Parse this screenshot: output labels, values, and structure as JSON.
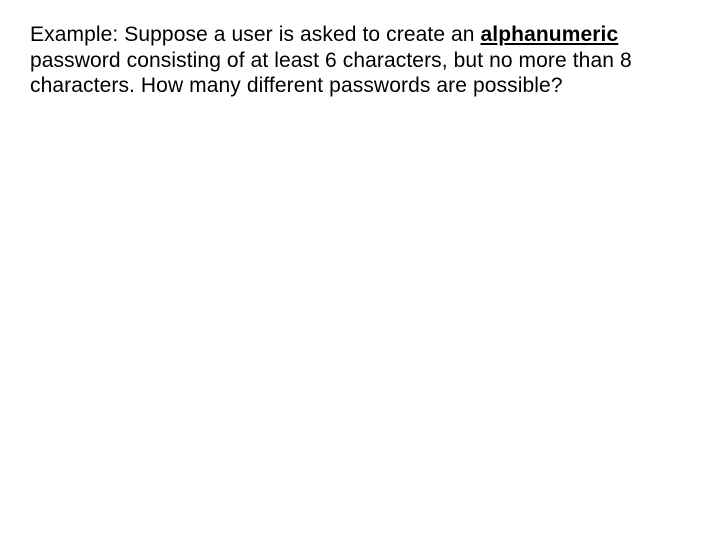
{
  "slide": {
    "prefix": "Example:  Suppose a user is asked to create an ",
    "keyword": "alphanumeric",
    "rest": " password consisting of at least 6 characters, but no more than 8 characters.  How many different passwords are possible?"
  }
}
